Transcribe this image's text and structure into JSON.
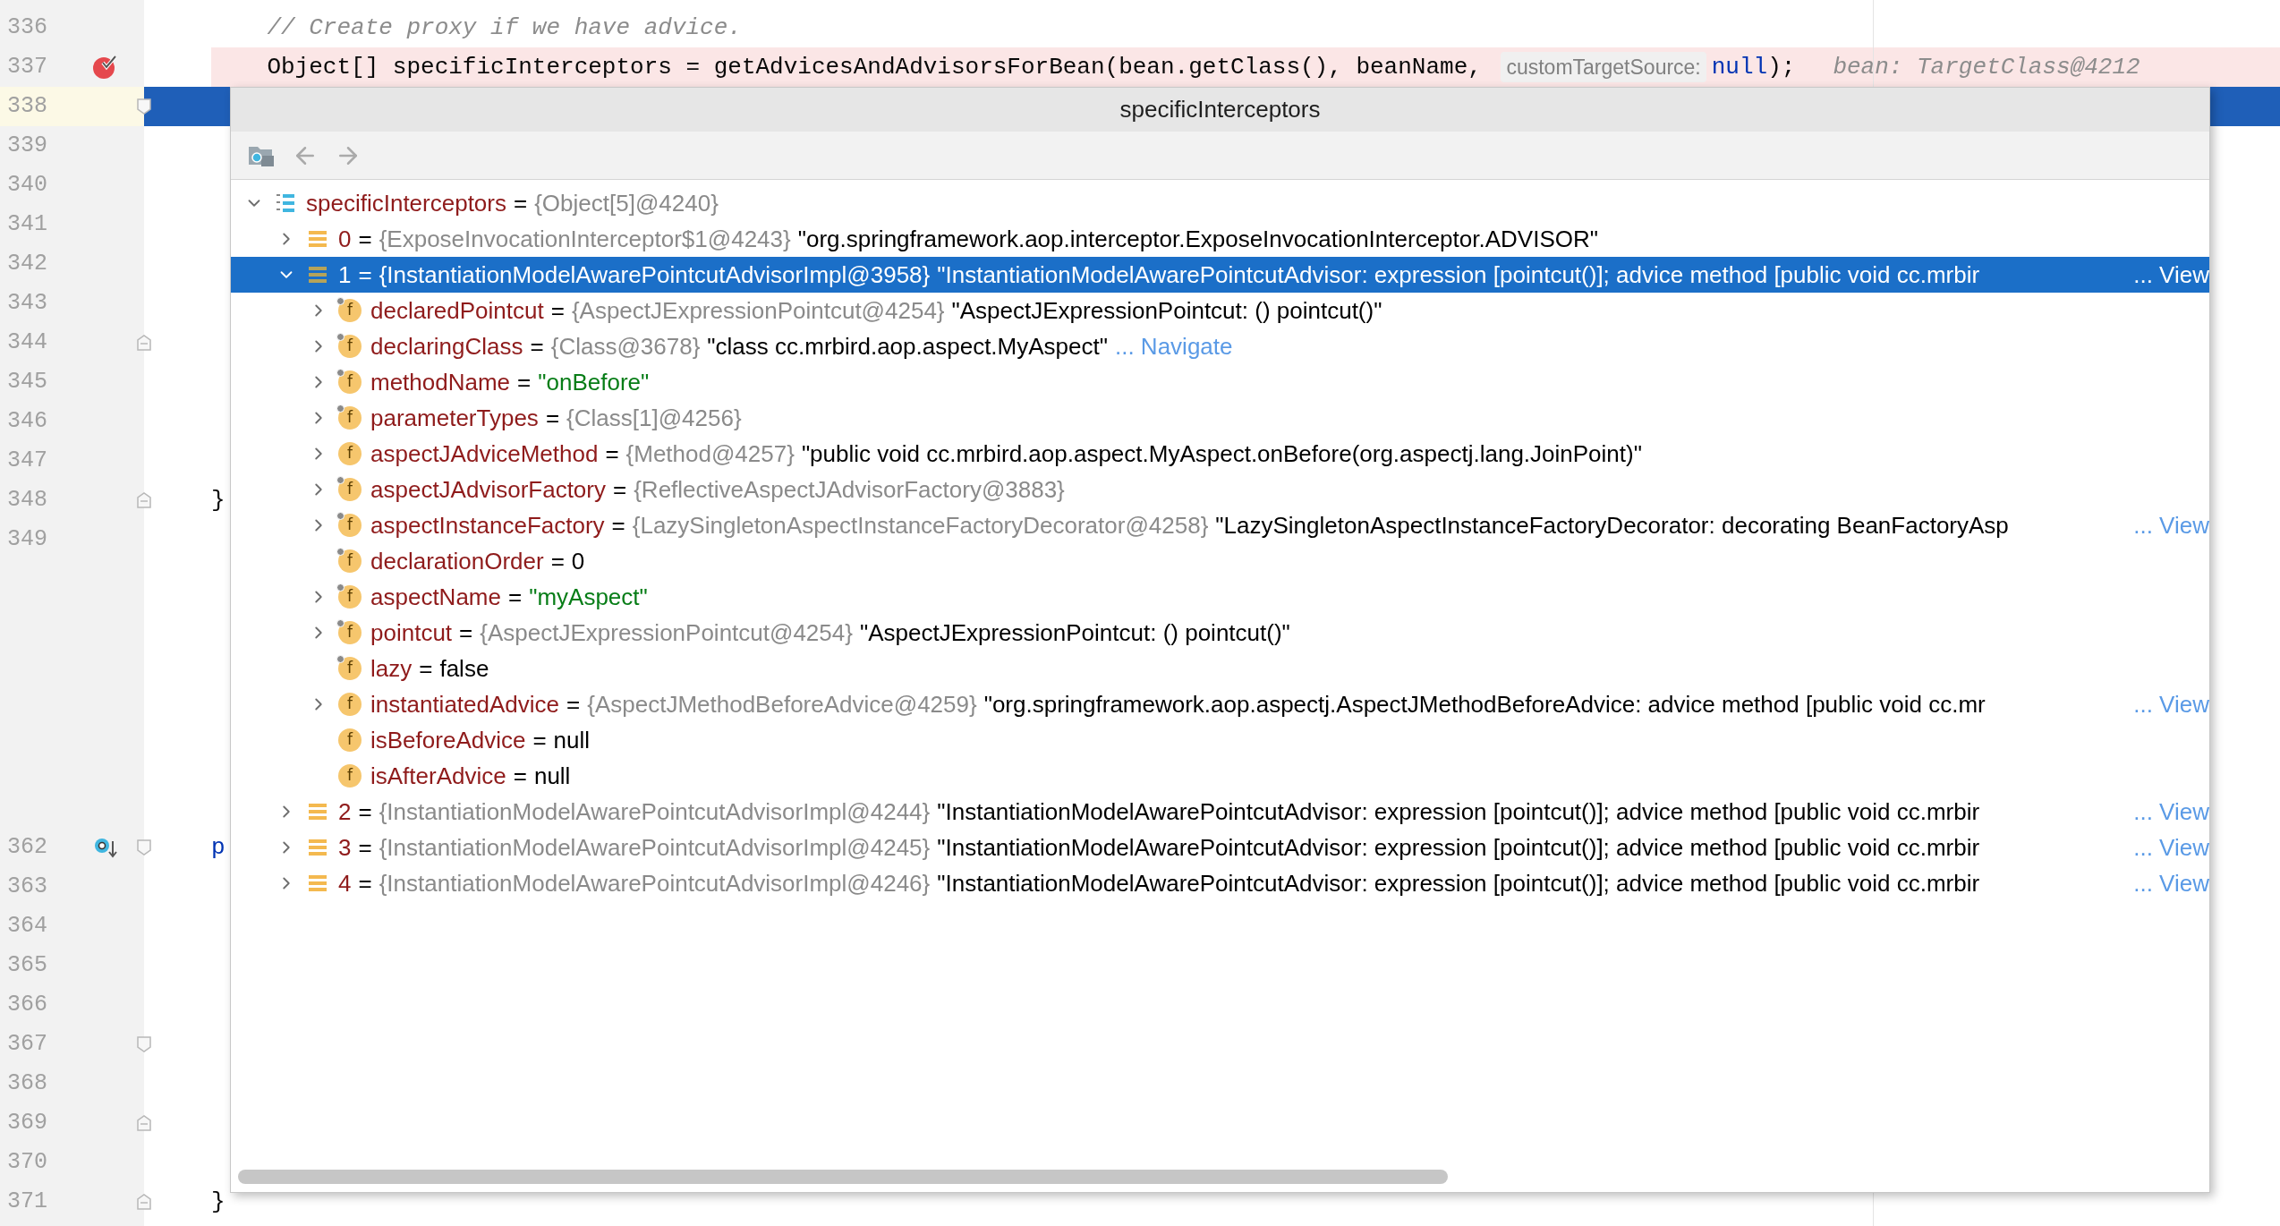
{
  "editor": {
    "line_groups": [
      [
        {
          "number": "336",
          "kind": "plain",
          "segments": [
            {
              "kind": "comment",
              "text": "    // Create proxy if we have advice."
            }
          ]
        },
        {
          "number": "337",
          "kind": "breakpoint",
          "icons": [
            {
              "kind": "breakpoint"
            }
          ],
          "segments": [
            {
              "kind": "code",
              "text": "    Object[] specificInterceptors = getAdvicesAndAdvisorsForBean(bean.getClass(), beanName, "
            },
            {
              "kind": "hint",
              "text": "customTargetSource:"
            },
            {
              "kind": "keyword",
              "text": "null"
            },
            {
              "kind": "code",
              "text": ");"
            },
            {
              "kind": "inline_value",
              "text": "bean: TargetClass@4212"
            }
          ]
        },
        {
          "number": "338",
          "kind": "execution",
          "icons": [
            {
              "kind": "fold_start"
            }
          ]
        },
        {
          "number": "339",
          "kind": "plain"
        },
        {
          "number": "340",
          "kind": "plain"
        },
        {
          "number": "341",
          "kind": "plain"
        },
        {
          "number": "342",
          "kind": "plain"
        },
        {
          "number": "343",
          "kind": "plain"
        },
        {
          "number": "344",
          "kind": "plain",
          "icons": [
            {
              "kind": "fold_end"
            }
          ]
        },
        {
          "number": "345",
          "kind": "plain"
        },
        {
          "number": "346",
          "kind": "plain"
        },
        {
          "number": "347",
          "kind": "plain"
        },
        {
          "number": "348",
          "kind": "plain",
          "icons": [
            {
              "kind": "fold_end"
            }
          ],
          "segments": [
            {
              "kind": "code",
              "text": "}"
            }
          ]
        },
        {
          "number": "349",
          "kind": "plain"
        }
      ],
      [
        {
          "number": "362",
          "kind": "plain",
          "icons": [
            {
              "kind": "implementation"
            },
            {
              "kind": "fold_start"
            }
          ],
          "segments": [
            {
              "kind": "keyword",
              "text": "p"
            }
          ]
        },
        {
          "number": "363",
          "kind": "plain"
        },
        {
          "number": "364",
          "kind": "plain"
        },
        {
          "number": "365",
          "kind": "plain"
        },
        {
          "number": "366",
          "kind": "plain"
        },
        {
          "number": "367",
          "kind": "plain",
          "icons": [
            {
              "kind": "fold_start"
            }
          ]
        },
        {
          "number": "368",
          "kind": "plain"
        },
        {
          "number": "369",
          "kind": "plain",
          "icons": [
            {
              "kind": "fold_end"
            }
          ]
        },
        {
          "number": "370",
          "kind": "plain"
        },
        {
          "number": "371",
          "kind": "plain",
          "icons": [
            {
              "kind": "fold_end"
            }
          ],
          "segments": [
            {
              "kind": "code",
              "text": "}"
            }
          ]
        }
      ]
    ]
  },
  "popup": {
    "title": "specificInterceptors",
    "back_enabled": false,
    "forward_enabled": false,
    "tree": {
      "nodes": [
        {
          "kind": "array",
          "name": "specificInterceptors",
          "equals": "=",
          "type": "{Object[5]@4240}",
          "expandable": true,
          "expanded": true,
          "selected": false,
          "children": [
            {
              "kind": "element",
              "name": "0",
              "equals": "=",
              "type": "{ExposeInvocationInterceptor$1@4243}",
              "value": {
                "kind": "object",
                "text": "\"org.springframework.aop.interceptor.ExposeInvocationInterceptor.ADVISOR\""
              },
              "expandable": true,
              "expanded": false,
              "selected": false
            },
            {
              "kind": "element",
              "name": "1",
              "equals": "=",
              "type": "{InstantiationModelAwarePointcutAdvisorImpl@3958}",
              "value": {
                "kind": "object",
                "text": "\"InstantiationModelAwarePointcutAdvisor: expression [pointcut()]; advice method [public void cc.mrbir"
              },
              "link": {
                "kind": "view",
                "text": "... View"
              },
              "expandable": true,
              "expanded": true,
              "selected": true,
              "children": [
                {
                  "kind": "field",
                  "badge": "f",
                  "final": true,
                  "name": "declaredPointcut",
                  "equals": "=",
                  "type": "{AspectJExpressionPointcut@4254}",
                  "value": {
                    "kind": "object",
                    "text": "\"AspectJExpressionPointcut: () pointcut()\""
                  },
                  "expandable": true,
                  "expanded": false,
                  "selected": false
                },
                {
                  "kind": "field",
                  "badge": "f",
                  "final": true,
                  "name": "declaringClass",
                  "equals": "=",
                  "type": "{Class@3678}",
                  "value": {
                    "kind": "object",
                    "text": "\"class cc.mrbird.aop.aspect.MyAspect\""
                  },
                  "link": {
                    "kind": "navigate",
                    "text": "... Navigate"
                  },
                  "expandable": true,
                  "expanded": false,
                  "selected": false
                },
                {
                  "kind": "field",
                  "badge": "f",
                  "final": true,
                  "name": "methodName",
                  "equals": "=",
                  "value": {
                    "kind": "string",
                    "text": "\"onBefore\""
                  },
                  "expandable": true,
                  "expanded": false,
                  "selected": false
                },
                {
                  "kind": "field",
                  "badge": "f",
                  "final": true,
                  "name": "parameterTypes",
                  "equals": "=",
                  "type": "{Class[1]@4256}",
                  "expandable": true,
                  "expanded": false,
                  "selected": false
                },
                {
                  "kind": "field",
                  "badge": "f",
                  "final": false,
                  "name": "aspectJAdviceMethod",
                  "equals": "=",
                  "type": "{Method@4257}",
                  "value": {
                    "kind": "object",
                    "text": "\"public void cc.mrbird.aop.aspect.MyAspect.onBefore(org.aspectj.lang.JoinPoint)\""
                  },
                  "expandable": true,
                  "expanded": false,
                  "selected": false
                },
                {
                  "kind": "field",
                  "badge": "f",
                  "final": true,
                  "name": "aspectJAdvisorFactory",
                  "equals": "=",
                  "type": "{ReflectiveAspectJAdvisorFactory@3883}",
                  "expandable": true,
                  "expanded": false,
                  "selected": false
                },
                {
                  "kind": "field",
                  "badge": "f",
                  "final": true,
                  "name": "aspectInstanceFactory",
                  "equals": "=",
                  "type": "{LazySingletonAspectInstanceFactoryDecorator@4258}",
                  "value": {
                    "kind": "object",
                    "text": "\"LazySingletonAspectInstanceFactoryDecorator: decorating BeanFactoryAsp"
                  },
                  "link": {
                    "kind": "view",
                    "text": "... View"
                  },
                  "expandable": true,
                  "expanded": false,
                  "selected": false
                },
                {
                  "kind": "field",
                  "badge": "f",
                  "final": true,
                  "name": "declarationOrder",
                  "equals": "=",
                  "value": {
                    "kind": "object",
                    "text": "0"
                  },
                  "expandable": false,
                  "selected": false
                },
                {
                  "kind": "field",
                  "badge": "f",
                  "final": true,
                  "name": "aspectName",
                  "equals": "=",
                  "value": {
                    "kind": "string",
                    "text": "\"myAspect\""
                  },
                  "expandable": true,
                  "expanded": false,
                  "selected": false
                },
                {
                  "kind": "field",
                  "badge": "f",
                  "final": true,
                  "name": "pointcut",
                  "equals": "=",
                  "type": "{AspectJExpressionPointcut@4254}",
                  "value": {
                    "kind": "object",
                    "text": "\"AspectJExpressionPointcut: () pointcut()\""
                  },
                  "expandable": true,
                  "expanded": false,
                  "selected": false
                },
                {
                  "kind": "field",
                  "badge": "f",
                  "final": true,
                  "name": "lazy",
                  "equals": "=",
                  "value": {
                    "kind": "object",
                    "text": "false"
                  },
                  "expandable": false,
                  "selected": false
                },
                {
                  "kind": "field",
                  "badge": "f",
                  "final": false,
                  "name": "instantiatedAdvice",
                  "equals": "=",
                  "type": "{AspectJMethodBeforeAdvice@4259}",
                  "value": {
                    "kind": "object",
                    "text": "\"org.springframework.aop.aspectj.AspectJMethodBeforeAdvice: advice method [public void cc.mr"
                  },
                  "link": {
                    "kind": "view",
                    "text": "... View"
                  },
                  "expandable": true,
                  "expanded": false,
                  "selected": false
                },
                {
                  "kind": "field",
                  "badge": "f",
                  "final": false,
                  "name": "isBeforeAdvice",
                  "equals": "=",
                  "value": {
                    "kind": "object",
                    "text": "null"
                  },
                  "expandable": false,
                  "selected": false
                },
                {
                  "kind": "field",
                  "badge": "f",
                  "final": false,
                  "name": "isAfterAdvice",
                  "equals": "=",
                  "value": {
                    "kind": "object",
                    "text": "null"
                  },
                  "expandable": false,
                  "selected": false
                }
              ]
            },
            {
              "kind": "element",
              "name": "2",
              "equals": "=",
              "type": "{InstantiationModelAwarePointcutAdvisorImpl@4244}",
              "value": {
                "kind": "object",
                "text": "\"InstantiationModelAwarePointcutAdvisor: expression [pointcut()]; advice method [public void cc.mrbir"
              },
              "link": {
                "kind": "view",
                "text": "... View"
              },
              "expandable": true,
              "expanded": false,
              "selected": false
            },
            {
              "kind": "element",
              "name": "3",
              "equals": "=",
              "type": "{InstantiationModelAwarePointcutAdvisorImpl@4245}",
              "value": {
                "kind": "object",
                "text": "\"InstantiationModelAwarePointcutAdvisor: expression [pointcut()]; advice method [public void cc.mrbir"
              },
              "link": {
                "kind": "view",
                "text": "... View"
              },
              "expandable": true,
              "expanded": false,
              "selected": false
            },
            {
              "kind": "element",
              "name": "4",
              "equals": "=",
              "type": "{InstantiationModelAwarePointcutAdvisorImpl@4246}",
              "value": {
                "kind": "object",
                "text": "\"InstantiationModelAwarePointcutAdvisor: expression [pointcut()]; advice method [public void cc.mrbir"
              },
              "link": {
                "kind": "view",
                "text": "... View"
              },
              "expandable": true,
              "expanded": false,
              "selected": false
            }
          ]
        }
      ]
    }
  }
}
